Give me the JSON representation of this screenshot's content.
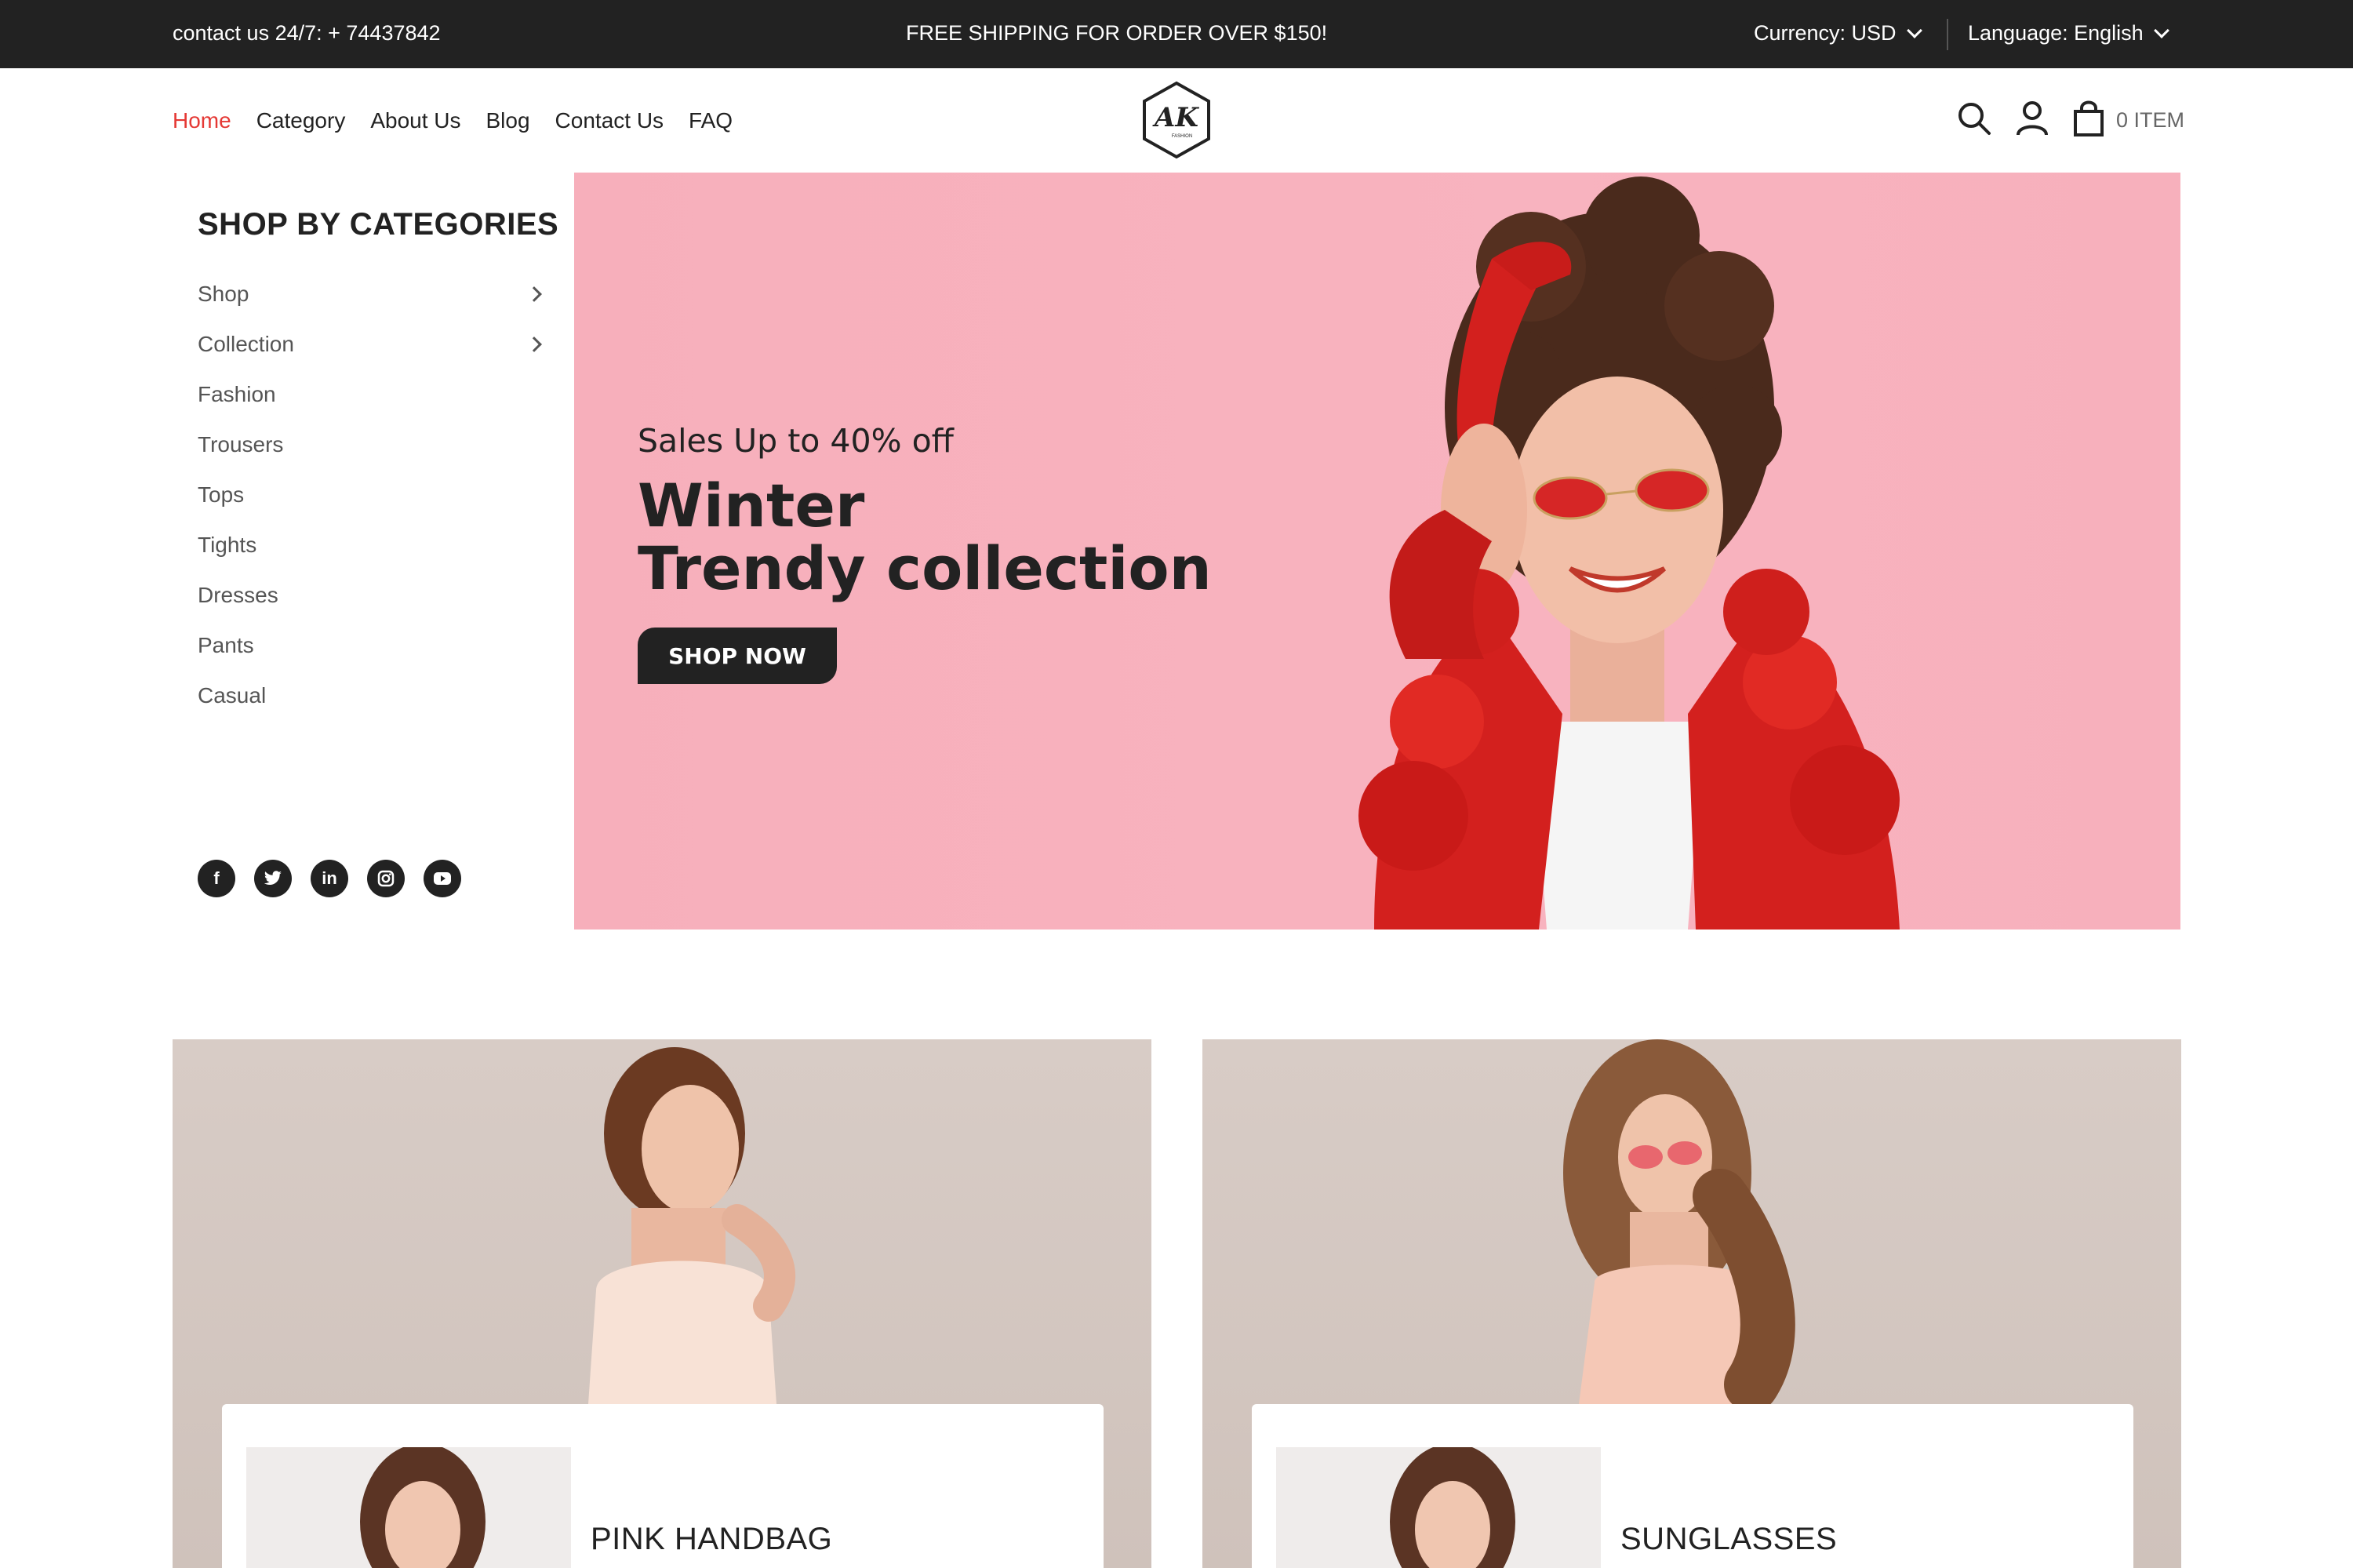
{
  "topbar": {
    "contact": "contact us 24/7: + 74437842",
    "shipping": "FREE SHIPPING FOR ORDER OVER $150!",
    "currency": "Currency: USD",
    "language": "Language: English"
  },
  "nav": {
    "items": [
      "Home",
      "Category",
      "About Us",
      "Blog",
      "Contact Us",
      "FAQ"
    ],
    "active": "Home"
  },
  "logo": {
    "text": "AK",
    "subtext": "FASHION"
  },
  "cart": {
    "label": "0 ITEM"
  },
  "sidebar": {
    "title": "SHOP BY CATEGORIES",
    "categories": [
      {
        "label": "Shop",
        "has_submenu": true
      },
      {
        "label": "Collection",
        "has_submenu": true
      },
      {
        "label": "Fashion",
        "has_submenu": false
      },
      {
        "label": "Trousers",
        "has_submenu": false
      },
      {
        "label": "Tops",
        "has_submenu": false
      },
      {
        "label": "Tights",
        "has_submenu": false
      },
      {
        "label": "Dresses",
        "has_submenu": false
      },
      {
        "label": "Pants",
        "has_submenu": false
      },
      {
        "label": "Casual",
        "has_submenu": false
      }
    ],
    "socials": [
      "facebook-icon",
      "twitter-icon",
      "linkedin-icon",
      "instagram-icon",
      "youtube-icon"
    ]
  },
  "hero": {
    "subtitle": "Sales Up to 40% off",
    "title_line1": "Winter",
    "title_line2": "Trendy collection",
    "button": "SHOP NOW"
  },
  "promos": [
    {
      "name": "PINK HANDBAG"
    },
    {
      "name": "SUNGLASSES"
    }
  ],
  "colors": {
    "topbar_bg": "#222222",
    "accent": "#e53935",
    "hero_bg": "#f7b0bc"
  }
}
